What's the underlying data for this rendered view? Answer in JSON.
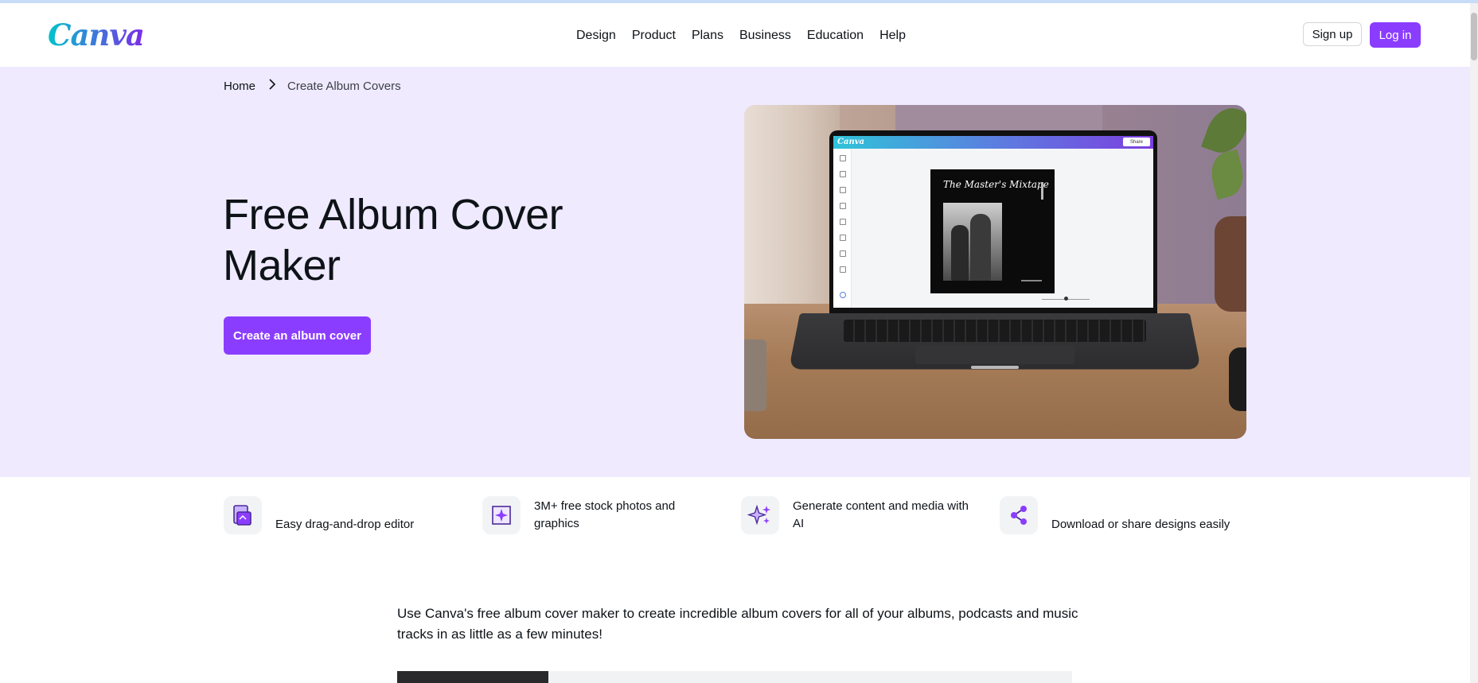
{
  "header": {
    "logo": "Canva",
    "nav": [
      "Design",
      "Product",
      "Plans",
      "Business",
      "Education",
      "Help"
    ],
    "signup_label": "Sign up",
    "login_label": "Log in"
  },
  "breadcrumb": {
    "home": "Home",
    "current": "Create Album Covers"
  },
  "hero": {
    "title": "Free Album Cover Maker",
    "cta_label": "Create an album cover",
    "editor_logo": "Canva",
    "editor_share": "Share",
    "cover_title": "The Master's Mixtape"
  },
  "features": [
    {
      "icon": "drag-drop-editor-icon",
      "label": "Easy drag-and-drop editor"
    },
    {
      "icon": "stock-photos-icon",
      "label": "3M+ free stock photos and graphics"
    },
    {
      "icon": "sparkles-ai-icon",
      "label": "Generate content and media with AI"
    },
    {
      "icon": "share-icon",
      "label": "Download or share designs easily"
    }
  ],
  "intro": "Use Canva's free album cover maker to create incredible album covers for all of your albums, podcasts and music tracks in as little as a few minutes!",
  "colors": {
    "brand_purple": "#8b3dff",
    "hero_bg": "#efeafe",
    "logo_cyan": "#00c4cc"
  }
}
